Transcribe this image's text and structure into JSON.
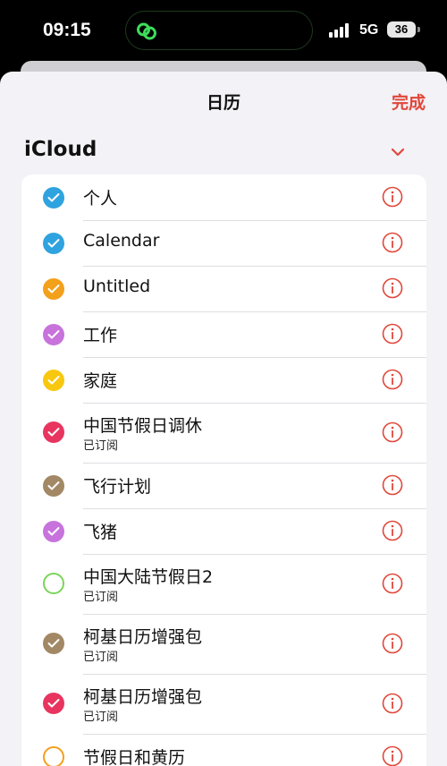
{
  "status_bar": {
    "time": "09:15",
    "network": "5G",
    "battery": "36"
  },
  "header": {
    "title": "日历",
    "done_label": "完成"
  },
  "section": {
    "title": "iCloud"
  },
  "colors": {
    "accent": "#e0473a",
    "blue": "#2ea3df",
    "orange": "#f3a01b",
    "purple": "#c873dc",
    "yellow": "#f8c810",
    "pink": "#e8355f",
    "brown": "#a28865",
    "green": "#7bd45a"
  },
  "calendars": [
    {
      "name": "个人",
      "subtitle": "",
      "color": "#2ea3df",
      "checked": true
    },
    {
      "name": "Calendar",
      "subtitle": "",
      "color": "#2ea3df",
      "checked": true
    },
    {
      "name": "Untitled",
      "subtitle": "",
      "color": "#f3a01b",
      "checked": true
    },
    {
      "name": "工作",
      "subtitle": "",
      "color": "#c873dc",
      "checked": true
    },
    {
      "name": "家庭",
      "subtitle": "",
      "color": "#f8c810",
      "checked": true
    },
    {
      "name": "中国节假日调休",
      "subtitle": "已订阅",
      "color": "#e8355f",
      "checked": true
    },
    {
      "name": "飞行计划",
      "subtitle": "",
      "color": "#a28865",
      "checked": true
    },
    {
      "name": "飞猪",
      "subtitle": "",
      "color": "#c873dc",
      "checked": true
    },
    {
      "name": "中国大陆节假日2",
      "subtitle": "已订阅",
      "color": "#7bd45a",
      "checked": false
    },
    {
      "name": "柯基日历增强包",
      "subtitle": "已订阅",
      "color": "#a28865",
      "checked": true
    },
    {
      "name": "柯基日历增强包",
      "subtitle": "已订阅",
      "color": "#e8355f",
      "checked": true
    },
    {
      "name": "节假日和黄历",
      "subtitle": "",
      "color": "#f3a01b",
      "checked": false
    }
  ]
}
